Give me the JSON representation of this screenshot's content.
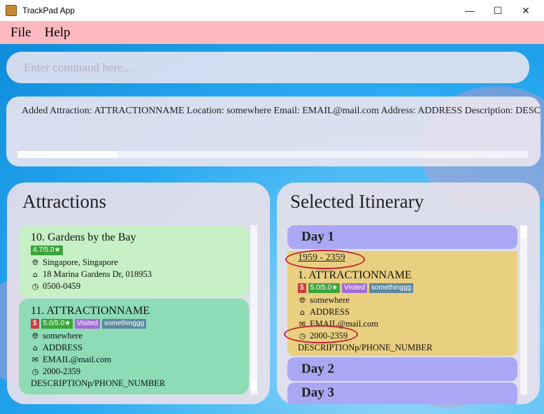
{
  "window": {
    "title": "TrackPad App",
    "minimize": "—",
    "maximize": "☐",
    "close": "✕"
  },
  "menu": {
    "file": "File",
    "help": "Help"
  },
  "command": {
    "placeholder": "Enter command here..."
  },
  "result": {
    "text": "Added Attraction: ATTRACTIONNAME Location: somewhere Email: EMAIL@mail.com Address: ADDRESS Description: DESCRIPTION"
  },
  "attractions": {
    "title": "Attractions",
    "items": [
      {
        "index_name": "10.  Gardens by the Bay",
        "rating": "4.7/5.0★",
        "location": "Singapore, Singapore",
        "address": "18 Marina Gardens Dr, 018953",
        "hours": "0500-0459"
      },
      {
        "index_name": "11.  ATTRACTIONNAME",
        "price": "$",
        "rating": "5.0/5.0★",
        "status": "Visited",
        "tag": "somethinggg",
        "location": "somewhere",
        "address": "ADDRESS",
        "email": "EMAIL@mail.com",
        "hours": "2000-2359",
        "description": "DESCRIPTIONp/PHONE_NUMBER"
      }
    ]
  },
  "itinerary": {
    "title": "Selected Itinerary",
    "days": [
      "Day 1",
      "Day 2",
      "Day 3"
    ],
    "slot": {
      "time": "1959 - 2359",
      "index_name": "1.  ATTRACTIONNAME",
      "price": "$",
      "rating": "5.0/5.0★",
      "status": "Visited",
      "tag": "somethinggg",
      "location": "somewhere",
      "address": "ADDRESS",
      "email": "EMAIL@mail.com",
      "hours": "2000-2359",
      "description": "DESCRIPTIONp/PHONE_NUMBER"
    }
  },
  "icons": {
    "location": "globe-icon",
    "address": "home-icon",
    "email": "mail-icon",
    "hours": "clock-icon"
  },
  "colors": {
    "menubar": "#ffb8c0",
    "card_green": "#c8f0c6",
    "card_teal": "#8ddcb6",
    "day_header": "#aaa8f4",
    "slot": "#e9cf80",
    "annotation": "#c22030"
  }
}
